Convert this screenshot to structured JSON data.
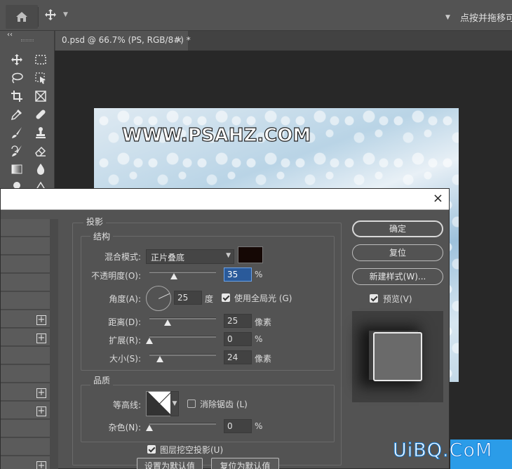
{
  "topbar": {
    "right_text": "点按并拖移可"
  },
  "tools": {
    "collapse": "‹‹"
  },
  "document": {
    "tab_title": "0.psd @ 66.7% (PS, RGB/8#) *",
    "tab_close": "×"
  },
  "canvas": {
    "watermark": "WWW.PSAHZ.COM"
  },
  "dialog": {
    "close": "×",
    "section_title": "投影",
    "structure_legend": "结构",
    "blend_mode_label": "混合模式:",
    "blend_mode_value": "正片叠底",
    "shadow_color": "#150805",
    "opacity_label": "不透明度(O):",
    "opacity_value": "35",
    "opacity_unit": "%",
    "angle_label": "角度(A):",
    "angle_value": "25",
    "angle_unit": "度",
    "global_light_label": "使用全局光 (G)",
    "global_light_checked": true,
    "distance_label": "距离(D):",
    "distance_value": "25",
    "distance_unit": "像素",
    "spread_label": "扩展(R):",
    "spread_value": "0",
    "spread_unit": "%",
    "size_label": "大小(S):",
    "size_value": "24",
    "size_unit": "像素",
    "quality_legend": "品质",
    "contour_label": "等高线:",
    "antialias_label": "消除锯齿 (L)",
    "antialias_checked": false,
    "noise_label": "杂色(N):",
    "noise_value": "0",
    "noise_unit": "%",
    "knockout_label": "图层挖空投影(U)",
    "knockout_checked": true,
    "set_default_label": "设置为默认值",
    "reset_default_label": "复位为默认值",
    "ok_label": "确定",
    "reset_label": "复位",
    "new_style_label": "新建样式(W)...",
    "preview_label": "预览(V)",
    "preview_checked": true,
    "plus_symbol": "+"
  },
  "logo": {
    "text": "UiBQ.CoM"
  }
}
